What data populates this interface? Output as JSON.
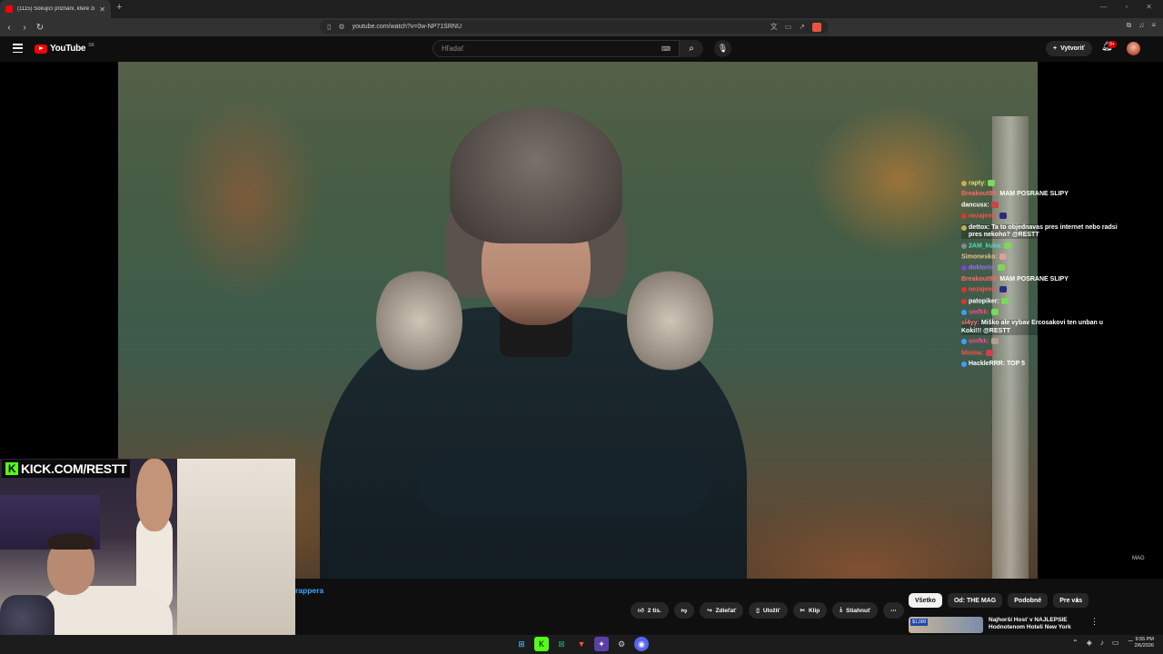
{
  "browser": {
    "tab_title": "(1115) Šokující přiznání, které zn",
    "url": "youtube.com/watch?v=0w-NP71SRNU"
  },
  "youtube": {
    "logo_text": "YouTube",
    "country_code": "SK",
    "search_placeholder": "Hľadať",
    "create_label": "Vytvoriť",
    "notifications_badge": "9+"
  },
  "chat": [
    {
      "name": "rapty:",
      "name_color": "#e0e070",
      "text": "",
      "emote": "#7bd957",
      "dot": "#c0b050"
    },
    {
      "name": "Breakout88:",
      "name_color": "#ff6a6a",
      "text": "MAM POSRANE SLIPY",
      "emote": "",
      "dot": ""
    },
    {
      "name": "dancusx:",
      "name_color": "#ffffff",
      "text": "",
      "emote": "#c44",
      "dot": ""
    },
    {
      "name": "nezajemi:",
      "name_color": "#ff5050",
      "text": "",
      "emote": "#2a2a80",
      "dot": "#d33"
    },
    {
      "name": "dettox:",
      "name_color": "#ffffff",
      "text": "Ta to objednavas pres internet nebo radsi pres nekoho? @RESTT",
      "emote": "",
      "dot": "#c0b050",
      "highlight": true
    },
    {
      "name": "2AM_kuba:",
      "name_color": "#4fe0c0",
      "text": "",
      "emote": "#7bd957",
      "dot": "#888"
    },
    {
      "name": "Simonesko:",
      "name_color": "#f0c090",
      "text": "",
      "emote": "#d9a0a0",
      "dot": ""
    },
    {
      "name": "doktoris:",
      "name_color": "#a070ff",
      "text": "",
      "emote": "#7bd957",
      "dot": "#8040d0"
    },
    {
      "name": "Breakout88:",
      "name_color": "#ff6a6a",
      "text": "MAM POSRANE SLIPY",
      "emote": "",
      "dot": ""
    },
    {
      "name": "nezajemi:",
      "name_color": "#ff5050",
      "text": "",
      "emote": "#2a2a80",
      "dot": "#d33"
    },
    {
      "name": "patopiker:",
      "name_color": "#ffffff",
      "text": "",
      "emote": "#7bd957",
      "dot": "#d33"
    },
    {
      "name": "smfkk:",
      "name_color": "#ff4a8a",
      "text": "",
      "emote": "#7bd957",
      "dot": "#3aa0ff"
    },
    {
      "name": "sl4yy:",
      "name_color": "#ff7a7a",
      "text": "Miško ale vybav Ercosakovi ten unban u Koki!!! @RESTT",
      "emote": "",
      "dot": "",
      "highlight": true
    },
    {
      "name": "smfkk:",
      "name_color": "#ff4a8a",
      "text": "",
      "emote": "#b0a090",
      "dot": "#3aa0ff"
    },
    {
      "name": "Mistoa:",
      "name_color": "#ff5050",
      "text": "",
      "emote": "#c44",
      "dot": ""
    },
    {
      "name": "HackleRRR:",
      "name_color": "#ffffff",
      "text": "TOP 5",
      "emote": "",
      "dot": "#3aa0ff"
    }
  ],
  "overlay": {
    "kick_url": "KICK.COM/RESTT",
    "watermark": "MAG"
  },
  "video": {
    "title_fragment": "rappera"
  },
  "actions": {
    "like_count": "2 tis.",
    "share": "Zdieľať",
    "save": "Uložiť",
    "clip": "Klip",
    "download": "Stiahnuť"
  },
  "chips": [
    "Všetko",
    "Od: THE MAG",
    "Podobné",
    "Pre vás"
  ],
  "recommendation": {
    "price_tag": "$1,000",
    "title": "Najhorší Hosť v NAJLEPŠIE Hodnotenom Hoteli New York"
  },
  "taskbar": {
    "time": "9:55 PM",
    "date": "2/6/2026"
  }
}
